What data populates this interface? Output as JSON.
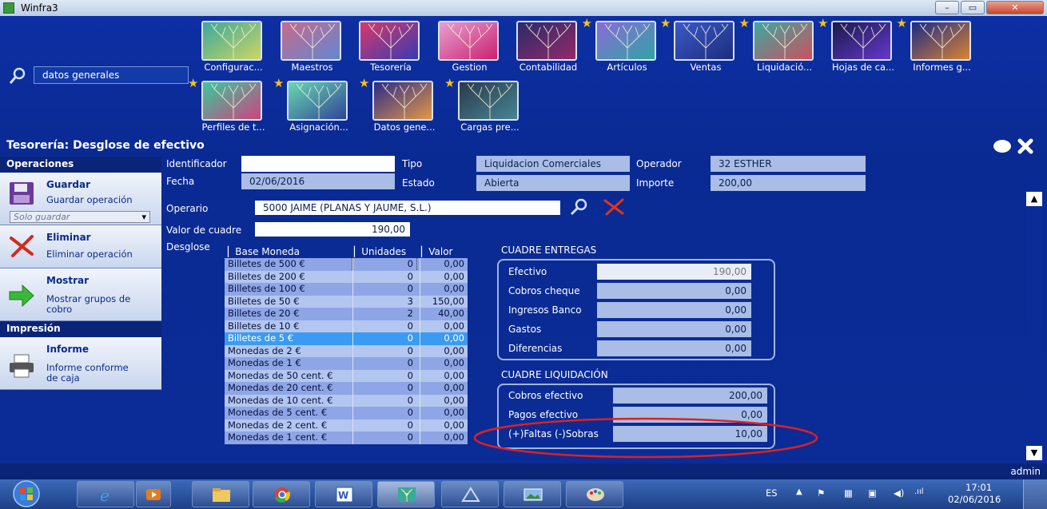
{
  "window": {
    "title": "Winfra3",
    "min": "–",
    "max": "▭",
    "close": "✕"
  },
  "search": {
    "value": "datos generales"
  },
  "tiles_row1": [
    {
      "label": "Configurac...",
      "star": false,
      "c1": "#3aa89a",
      "c2": "#d8d860"
    },
    {
      "label": "Maestros",
      "star": false,
      "c1": "#c66a8a",
      "c2": "#5a8ad8"
    },
    {
      "label": "Tesorería",
      "star": false,
      "c1": "#d83a6a",
      "c2": "#2a3ab8"
    },
    {
      "label": "Gestion",
      "star": false,
      "c1": "#e8a0d0",
      "c2": "#c8186a"
    },
    {
      "label": "Contabilidad",
      "star": false,
      "c1": "#2a2a6a",
      "c2": "#9a2a6a"
    },
    {
      "label": "Artículos",
      "star": true,
      "c1": "#8a6ad8",
      "c2": "#2aa8a0"
    },
    {
      "label": "Ventas",
      "star": true,
      "c1": "#3a5ac8",
      "c2": "#1a2a78"
    },
    {
      "label": "Liquidació...",
      "star": true,
      "c1": "#3aa8a0",
      "c2": "#d84a5a"
    },
    {
      "label": "Hojas de ca...",
      "star": true,
      "c1": "#1a1a4a",
      "c2": "#6a3ad8"
    },
    {
      "label": "Informes g...",
      "star": true,
      "c1": "#1a2a88",
      "c2": "#e88a2a"
    }
  ],
  "tiles_row2": [
    {
      "label": "Perfiles de t...",
      "star": true,
      "c1": "#3ac8a0",
      "c2": "#d83a7a"
    },
    {
      "label": "Asignación...",
      "star": true,
      "c1": "#6ad8b0",
      "c2": "#2a3a98"
    },
    {
      "label": "Datos gene...",
      "star": true,
      "c1": "#2a2a88",
      "c2": "#f0a040"
    },
    {
      "label": "Cargas pre...",
      "star": true,
      "c1": "#2a3a4a",
      "c2": "#4a8a9a"
    }
  ],
  "page_title": "Tesorería: Desglose de efectivo",
  "left": {
    "operaciones": "Operaciones",
    "guardar": "Guardar",
    "guardar_sub": "Guardar operación",
    "guardar_mode": "Solo guardar",
    "eliminar": "Eliminar",
    "eliminar_sub": "Eliminar operación",
    "mostrar": "Mostrar",
    "mostrar_sub1": "Mostrar grupos de",
    "mostrar_sub2": "cobro",
    "impresion": "Impresión",
    "informe": "Informe",
    "informe_sub1": "Informe conforme",
    "informe_sub2": "de caja"
  },
  "form": {
    "identificador_label": "Identificador",
    "identificador": "",
    "fecha_label": "Fecha",
    "fecha": "02/06/2016",
    "tipo_label": "Tipo",
    "tipo": "Liquidacion Comerciales",
    "estado_label": "Estado",
    "estado": "Abierta",
    "operador_label": "Operador",
    "operador": "32 ESTHER",
    "importe_label": "Importe",
    "importe": "200,00",
    "operario_label": "Operario",
    "operario": "5000 JAIME (PLANAS Y JAUME, S.L.)",
    "valor_cuadre_label": "Valor de cuadre",
    "valor_cuadre": "190,00",
    "desglose_label": "Desglose"
  },
  "grid": {
    "headers": [
      "Base Moneda",
      "Unidades",
      "Valor"
    ],
    "rows": [
      [
        "Billetes de 500 €",
        "0",
        "0,00"
      ],
      [
        "Billetes de 200 €",
        "0",
        "0,00"
      ],
      [
        "Billetes de 100 €",
        "0",
        "0,00"
      ],
      [
        "Billetes de 50 €",
        "3",
        "150,00"
      ],
      [
        "Billetes de 20 €",
        "2",
        "40,00"
      ],
      [
        "Billetes de 10 €",
        "0",
        "0,00"
      ],
      [
        "Billetes de 5 €",
        "0",
        "0,00"
      ],
      [
        "Monedas de 2 €",
        "0",
        "0,00"
      ],
      [
        "Monedas de 1 €",
        "0",
        "0,00"
      ],
      [
        "Monedas de 50 cent. €",
        "0",
        "0,00"
      ],
      [
        "Monedas de 20 cent. €",
        "0",
        "0,00"
      ],
      [
        "Monedas de 10 cent. €",
        "0",
        "0,00"
      ],
      [
        "Monedas de 5 cent. €",
        "0",
        "0,00"
      ],
      [
        "Monedas de 2 cent. €",
        "0",
        "0,00"
      ],
      [
        "Monedas de 1 cent. €",
        "0",
        "0,00"
      ]
    ],
    "selected_row": 6
  },
  "cuadre_entregas": {
    "title": "CUADRE ENTREGAS",
    "rows": [
      {
        "label": "Efectivo",
        "value": "190,00"
      },
      {
        "label": "Cobros cheque",
        "value": "0,00"
      },
      {
        "label": "Ingresos Banco",
        "value": "0,00"
      },
      {
        "label": "Gastos",
        "value": "0,00"
      },
      {
        "label": "Diferencias",
        "value": "0,00"
      }
    ]
  },
  "cuadre_liquidacion": {
    "title": "CUADRE LIQUIDACIÓN",
    "rows": [
      {
        "label": "Cobros efectivo",
        "value": "200,00"
      },
      {
        "label": "Pagos efectivo",
        "value": "0,00"
      },
      {
        "label": "(+)Faltas (-)Sobras",
        "value": "10,00"
      }
    ]
  },
  "status_user": "admin",
  "taskbar": {
    "lang": "ES",
    "time": "17:01",
    "date": "02/06/2016"
  },
  "colors": {
    "accent": "#0b2c96",
    "annotation": "#e02020",
    "selected_row": "#3a9bf2"
  }
}
